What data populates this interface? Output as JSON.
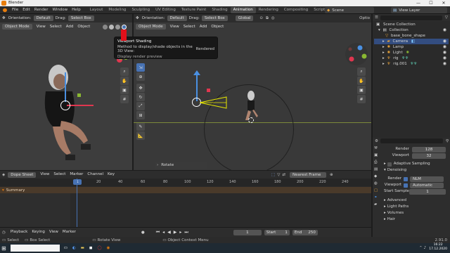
{
  "window": {
    "title": "Blender",
    "controls": [
      "—",
      "☐",
      "✕"
    ]
  },
  "menu": [
    "File",
    "Edit",
    "Render",
    "Window",
    "Help"
  ],
  "workspaces": [
    "Layout",
    "Modeling",
    "Sculpting",
    "UV Editing",
    "Texture Paint",
    "Shading",
    "Animation",
    "Rendering",
    "Compositing",
    "Scripting"
  ],
  "active_workspace": "Animation",
  "scene": {
    "label": "Scene",
    "view_layer": "View Layer"
  },
  "left_vp": {
    "orientation_label": "Orientation:",
    "orientation_value": "Default",
    "drag_label": "Drag:",
    "select_box": "Select Box",
    "mode": "Object Mode",
    "header_menus": [
      "View",
      "Select",
      "Add",
      "Object"
    ]
  },
  "mid_vp": {
    "orientation_label": "Orientation:",
    "orientation_value": "Default",
    "drag_label": "Drag:",
    "select_box": "Select Box",
    "global": "Global",
    "mode": "Object Mode",
    "header_menus": [
      "View",
      "Select",
      "Add",
      "Object"
    ],
    "options": "Optio",
    "operator_panel": "Rotate"
  },
  "tooltip": {
    "title": "Viewport Shading",
    "body": "Method to display/shade objects in the 3D View:",
    "value": "Rendered",
    "sub": "Display render preview"
  },
  "dopesheet": {
    "mode": "Dope Sheet",
    "menus": [
      "View",
      "Select",
      "Marker",
      "Channel",
      "Key"
    ],
    "snap": "Nearest Frame",
    "summary": "Summary",
    "current_frame": "1",
    "ticks": [
      "20",
      "40",
      "60",
      "80",
      "100",
      "120",
      "140",
      "160",
      "180",
      "200",
      "220",
      "240"
    ]
  },
  "timeline": {
    "menus": [
      "Playback",
      "Keying",
      "View",
      "Marker"
    ],
    "frame": "1",
    "start_label": "Start",
    "start": "1",
    "end_label": "End",
    "end": "250"
  },
  "outliner": {
    "root": "Scene Collection",
    "collection": "Collection",
    "items": [
      {
        "name": "base_bone_shape"
      },
      {
        "name": "Camera"
      },
      {
        "name": "Lamp"
      },
      {
        "name": "Light"
      },
      {
        "name": "rig"
      },
      {
        "name": "rig.001"
      }
    ]
  },
  "properties": {
    "render_label": "Render",
    "render_value": "128",
    "viewport_label": "Viewport",
    "viewport_value": "32",
    "adaptive": "Adaptive Sampling",
    "denoising": "Denoising",
    "render_denoiser_label": "Render",
    "render_denoiser": "NLM",
    "viewport_denoiser_label": "Viewport",
    "viewport_denoiser": "Automatic",
    "start_sample_label": "Start Sample",
    "start_sample": "1",
    "sections": [
      "Advanced",
      "Light Paths",
      "Volumes",
      "Hair"
    ]
  },
  "status": {
    "left": "Select",
    "box": "Box Select",
    "rotate": "Rotate View",
    "context": "Object Context Menu",
    "version": "2.91.0"
  },
  "taskbar": {
    "time": "16:22",
    "date": "17.12.2020"
  },
  "colors": {
    "accent": "#4772b3",
    "active_tab": "#474747",
    "orange": "#e87d0d",
    "x_axis": "#e0364f",
    "y_axis": "#8ab832",
    "z_axis": "#4a90e2"
  }
}
